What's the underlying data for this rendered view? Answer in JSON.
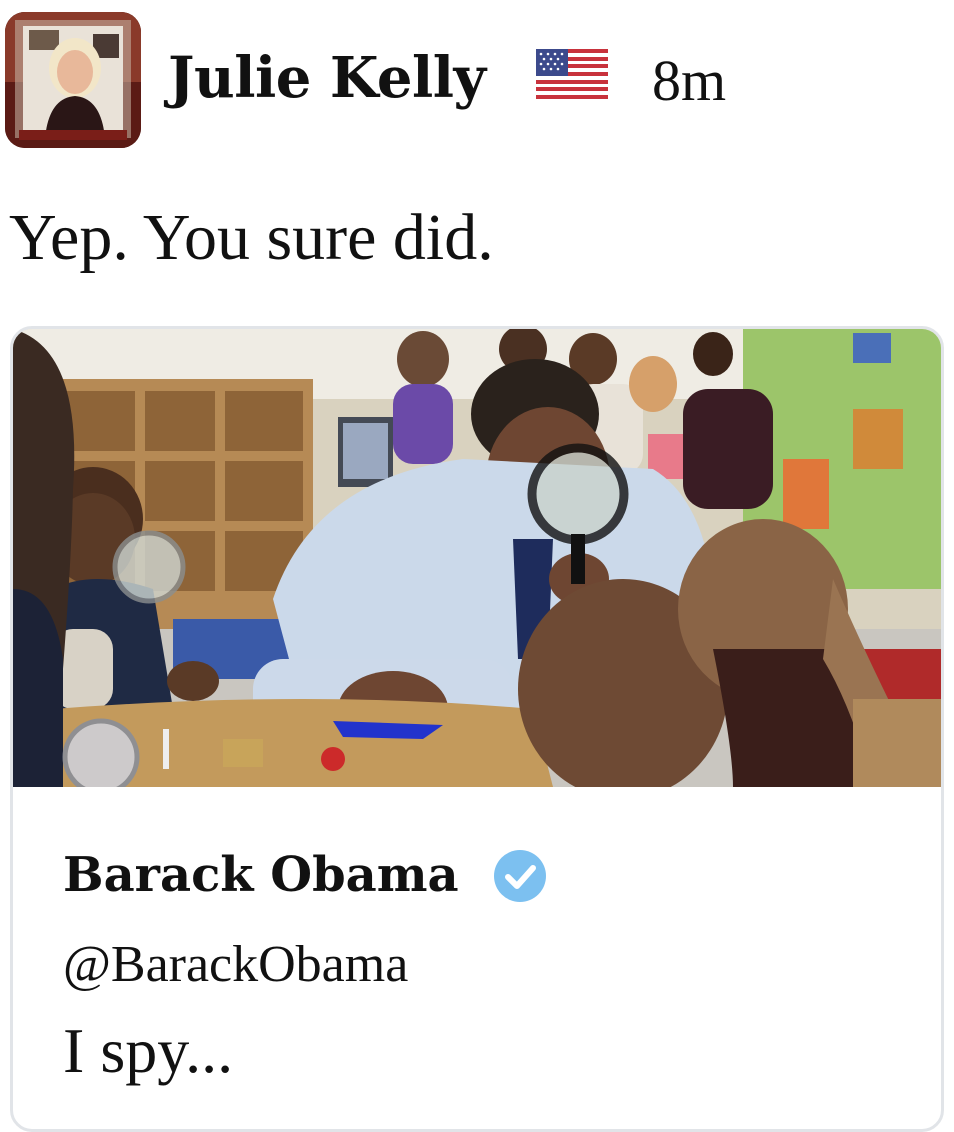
{
  "tweet": {
    "author": {
      "name": "Julie Kelly",
      "flag_icon": "us-flag-emoji",
      "avatar": "profile-photo"
    },
    "timestamp": "8m",
    "text": "Yep. You sure did."
  },
  "quoted_tweet": {
    "photo": "classroom-photo-magnifying-glass",
    "author_name": "Barack Obama",
    "verified_icon": "verified-badge-icon",
    "handle": "@BarackObama",
    "text": "I spy..."
  },
  "colors": {
    "verified": "#7cc0f0",
    "card_border": "#e1e4e8",
    "text": "#111111"
  }
}
